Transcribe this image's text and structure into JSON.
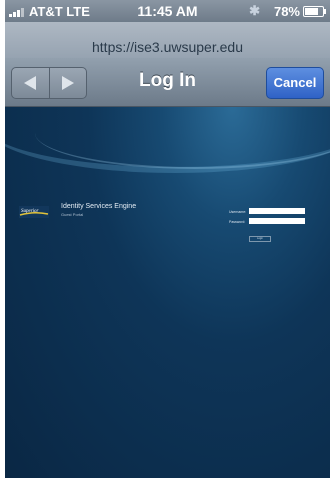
{
  "status_bar": {
    "carrier": "AT&T LTE",
    "time": "11:45 AM",
    "battery_percent": "78%",
    "battery_level": 0.78,
    "bluetooth_icon": "bluetooth-icon",
    "signal_icon": "signal-bars-icon"
  },
  "browser": {
    "url": "https://ise3.uwsuper.edu",
    "title": "Log In",
    "cancel_label": "Cancel",
    "back_icon": "back-arrow-icon",
    "forward_icon": "forward-arrow-icon"
  },
  "page": {
    "logo_text": "Superior",
    "product_title": "Identity Services Engine",
    "product_subtitle": "Guest Portal",
    "username_label": "Username:",
    "password_label": "Password:",
    "login_label": "Login",
    "username_value": "",
    "password_value": ""
  },
  "colors": {
    "accent": "#2f62c6",
    "page_bg": "#0b2a4a"
  }
}
